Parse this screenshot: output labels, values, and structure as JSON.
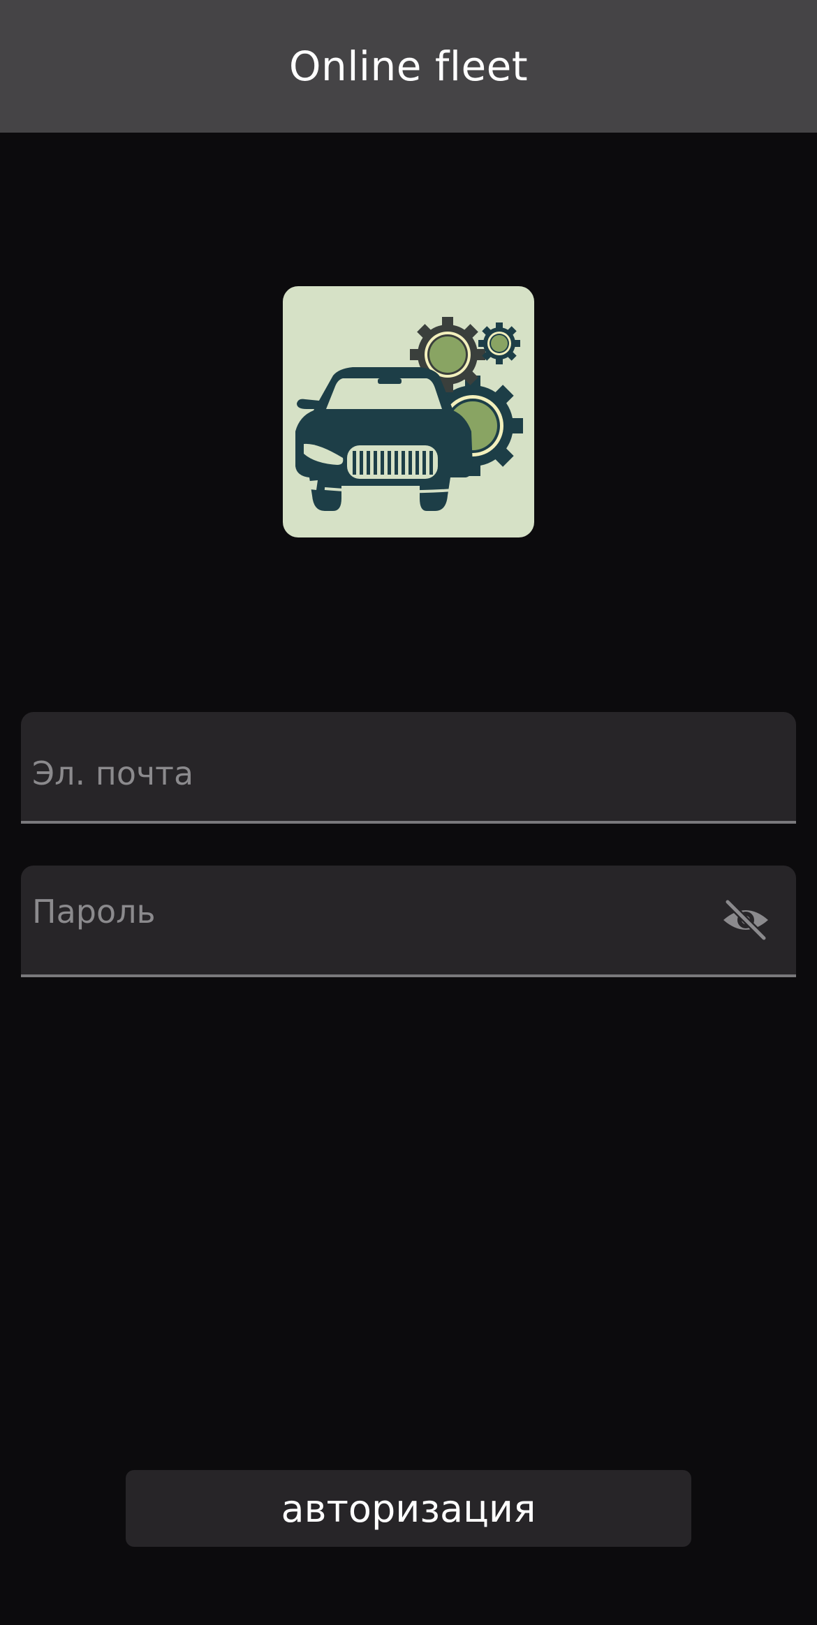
{
  "header": {
    "title": "Online fleet"
  },
  "logo": {
    "icon": "car-with-gears-icon",
    "colors": {
      "background": "#d6e1c6",
      "car": "#1d3e47",
      "gear_fill": "#89a463",
      "gear_ring": "#f3f0bd"
    }
  },
  "form": {
    "email": {
      "value": "",
      "placeholder": "Эл. почта"
    },
    "password": {
      "value": "",
      "placeholder": "Пароль",
      "visibility_icon": "eye-off-icon"
    },
    "submit_label": "авторизация"
  },
  "theme": {
    "background": "#0c0b0d",
    "header": "#454446",
    "field": "#272528",
    "underline": "#7a797c",
    "placeholder": "#8b8a8d"
  }
}
